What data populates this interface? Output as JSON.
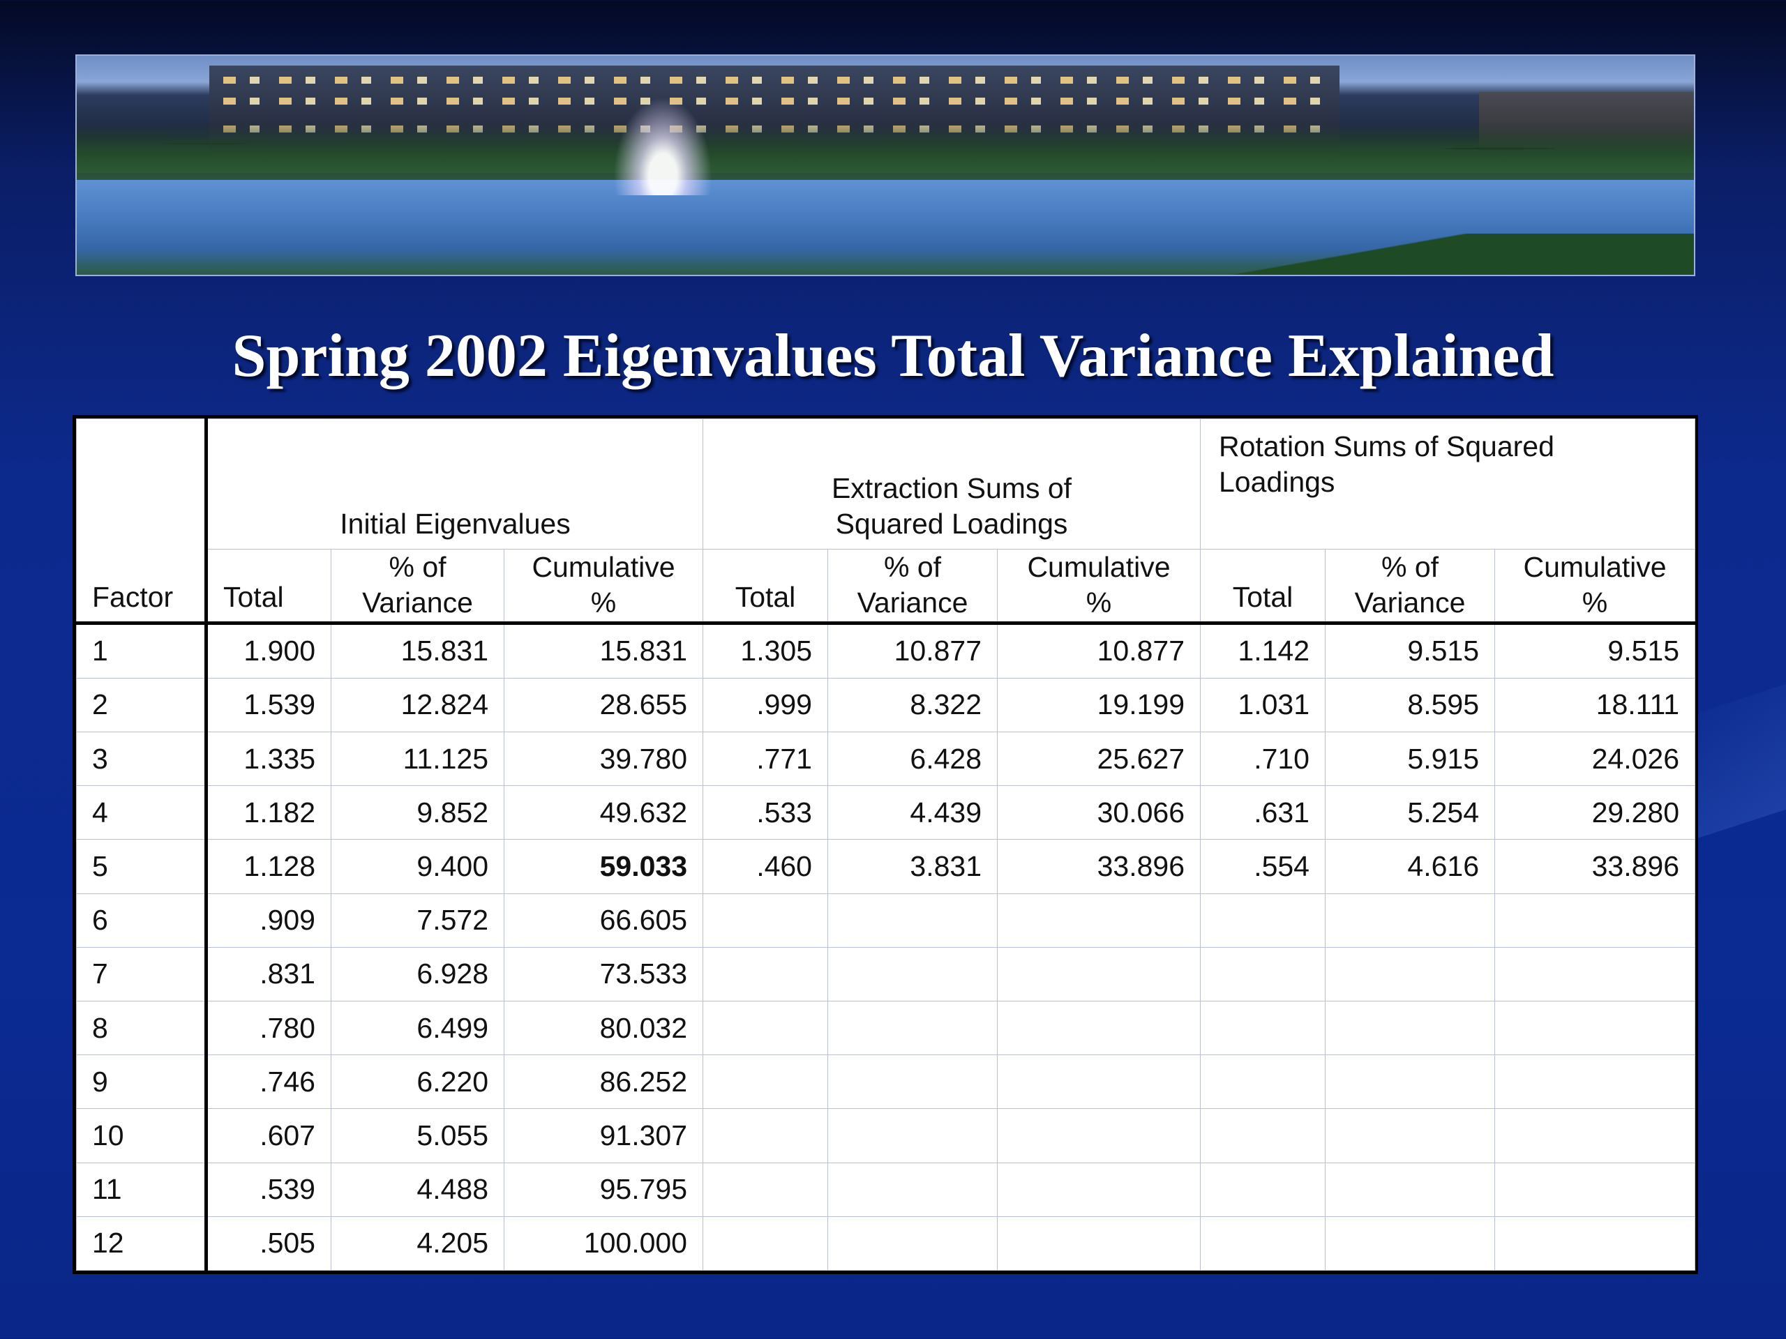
{
  "slide": {
    "title": "Spring 2002 Eigenvalues Total Variance Explained"
  },
  "table": {
    "factor_header": "Factor",
    "groups": [
      "Initial Eigenvalues",
      "Extraction Sums of Squared Loadings",
      "Rotation Sums of Squared Loadings"
    ],
    "subheaders": {
      "total": "Total",
      "pct": "% of Variance",
      "cum": "Cumulative %"
    },
    "rows": [
      [
        "1",
        "1.900",
        "15.831",
        "15.831",
        "1.305",
        "10.877",
        "10.877",
        "1.142",
        "9.515",
        "9.515"
      ],
      [
        "2",
        "1.539",
        "12.824",
        "28.655",
        ".999",
        "8.322",
        "19.199",
        "1.031",
        "8.595",
        "18.111"
      ],
      [
        "3",
        "1.335",
        "11.125",
        "39.780",
        ".771",
        "6.428",
        "25.627",
        ".710",
        "5.915",
        "24.026"
      ],
      [
        "4",
        "1.182",
        "9.852",
        "49.632",
        ".533",
        "4.439",
        "30.066",
        ".631",
        "5.254",
        "29.280"
      ],
      [
        "5",
        "1.128",
        "9.400",
        "59.033",
        ".460",
        "3.831",
        "33.896",
        ".554",
        "4.616",
        "33.896"
      ],
      [
        "6",
        ".909",
        "7.572",
        "66.605",
        "",
        "",
        "",
        "",
        "",
        ""
      ],
      [
        "7",
        ".831",
        "6.928",
        "73.533",
        "",
        "",
        "",
        "",
        "",
        ""
      ],
      [
        "8",
        ".780",
        "6.499",
        "80.032",
        "",
        "",
        "",
        "",
        "",
        ""
      ],
      [
        "9",
        ".746",
        "6.220",
        "86.252",
        "",
        "",
        "",
        "",
        "",
        ""
      ],
      [
        "10",
        ".607",
        "5.055",
        "91.307",
        "",
        "",
        "",
        "",
        "",
        ""
      ],
      [
        "11",
        ".539",
        "4.488",
        "95.795",
        "",
        "",
        "",
        "",
        "",
        ""
      ],
      [
        "12",
        ".505",
        "4.205",
        "100.000",
        "",
        "",
        "",
        "",
        "",
        ""
      ]
    ],
    "bold_cell": "59.033"
  },
  "banner": {
    "icon": "campus-fountain-photo"
  }
}
